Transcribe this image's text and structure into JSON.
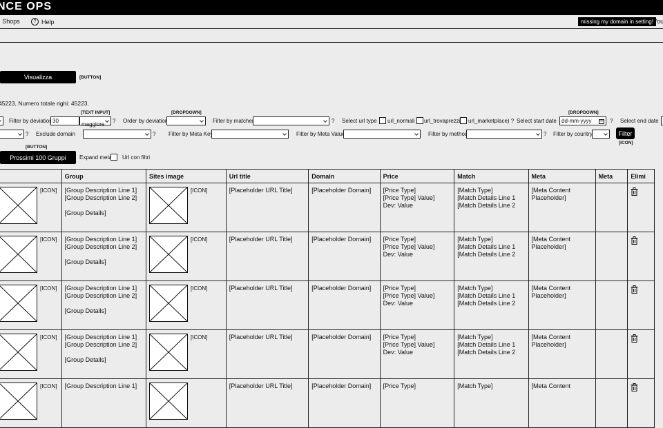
{
  "header": {
    "title": "NCE OPS"
  },
  "nav": {
    "shops_label": "Shops",
    "help_label": "Help",
    "help_symbol": "?",
    "notice": "missing my domain in setting!",
    "user": "You"
  },
  "visualizza": {
    "label": "Visualizza",
    "tag": "[BUTTON]"
  },
  "totals_text": "45223, Numero totale righi: 45223.",
  "filters": {
    "deviation_label": "Filter by deviation",
    "deviation_value": "30",
    "text_input_tag": "[TEXT INPUT]",
    "order_select_value": "maggiore",
    "help": "?",
    "order_label": "Order by deviation",
    "dropdown_tag": "[DROPDOWN]",
    "matcher_label": "Filter by matcher",
    "url_type_label": "Select url type",
    "url_normali": "url_normali",
    "url_trovaprezzi": "url_trovaprezzi",
    "url_marketplace": "url_marketplace) ?",
    "start_date_label": "Select start date",
    "start_date_placeholder": "dd-mm-yyyy",
    "end_date_label": "Select end date",
    "exclude_domain_label": "Exclude domain",
    "meta_key_label": "Filter by Meta Key",
    "meta_value_label": "Filter by Meta Value",
    "method_label": "Filter by method",
    "country_label": "Filter by country",
    "filter_button": "Filter",
    "icon_tag": "[ICON]"
  },
  "next_groups": {
    "label": "Prossimi 100 Gruppi",
    "tag": "[BUTTON]"
  },
  "expand_meta_label": "Expand meta",
  "url_con_filtri_label": "Url con filtri",
  "table": {
    "headers": [
      "",
      "Group",
      "Sites image",
      "Url title",
      "Domain",
      "Price",
      "Match",
      "Meta",
      "Meta",
      "Elimi"
    ],
    "rows": [
      {
        "icon_tag": "[ICON]",
        "group_line1": "[Group Description Line 1]",
        "group_line2": "[Group Description Line 2]",
        "group_details": "[Group Details]",
        "site_icon_tag": "[ICON]",
        "url_title": "[Placeholder URL Title]",
        "domain": "[Placeholder Domain]",
        "price_type": "[Price Type]",
        "price_value": "[Price Type] Value]",
        "dev": "Dev: Value",
        "match_type": "[Match Type]",
        "match_line1": "[Match Details Line 1",
        "match_line2": "[Match Details Line 2",
        "meta_line1": "[Meta Content",
        "meta_line2": "Placeholder]"
      },
      {
        "icon_tag": "[ICON]",
        "group_line1": "[Group Description Line 1]",
        "group_line2": "[Group Description Line 2]",
        "group_details": "[Group Details]",
        "site_icon_tag": "[ICON]",
        "url_title": "[Placeholder URL Title]",
        "domain": "[Placeholder Domain]",
        "price_type": "[Price Type]",
        "price_value": "[Price Type] Value]",
        "dev": "Dev: Value",
        "match_type": "[Match Type]",
        "match_line1": "[Match Details Line 1",
        "match_line2": "[Match Details Line 2",
        "meta_line1": "[Meta Content",
        "meta_line2": "Placeholder]"
      },
      {
        "icon_tag": "[ICON]",
        "group_line1": "[Group Description Line 1]",
        "group_line2": "[Group Description Line 2]",
        "group_details": "[Group Details]",
        "site_icon_tag": "[ICON]",
        "url_title": "[Placeholder URL Title]",
        "domain": "[Placeholder Domain]",
        "price_type": "[Price Type]",
        "price_value": "[Price Type] Value]",
        "dev": "Dev: Value",
        "match_type": "[Match Type]",
        "match_line1": "[Match Details Line 1",
        "match_line2": "[Match Details Line 2",
        "meta_line1": "[Meta Content",
        "meta_line2": "Placeholder]"
      },
      {
        "icon_tag": "[ICON]",
        "group_line1": "[Group Description Line 1]",
        "group_line2": "[Group Description Line 2]",
        "group_details": "[Group Details]",
        "site_icon_tag": "[ICON]",
        "url_title": "[Placeholder URL Title]",
        "domain": "[Placeholder Domain]",
        "price_type": "[Price Type]",
        "price_value": "[Price Type] Value]",
        "dev": "Dev: Value",
        "match_type": "[Match Type]",
        "match_line1": "[Match Details Line 1",
        "match_line2": "[Match Details Line 2",
        "meta_line1": "[Meta Content",
        "meta_line2": "Placeholder]"
      },
      {
        "icon_tag": "[ICON]",
        "group_line1": "[Group Description Line 1]",
        "group_line2": "",
        "group_details": "",
        "site_icon_tag": "",
        "url_title": "[Placeholder URL Title]",
        "domain": "[Placeholder Domain]",
        "price_type": "[Price Type]",
        "price_value": "",
        "dev": "",
        "match_type": "[Match Type]",
        "match_line1": "",
        "match_line2": "",
        "meta_line1": "[Meta Content",
        "meta_line2": ""
      }
    ]
  },
  "icons": {
    "help": "help-circle-icon",
    "calendar": "calendar-icon",
    "image_placeholder": "image-placeholder-icon",
    "trash": "trash-icon"
  }
}
